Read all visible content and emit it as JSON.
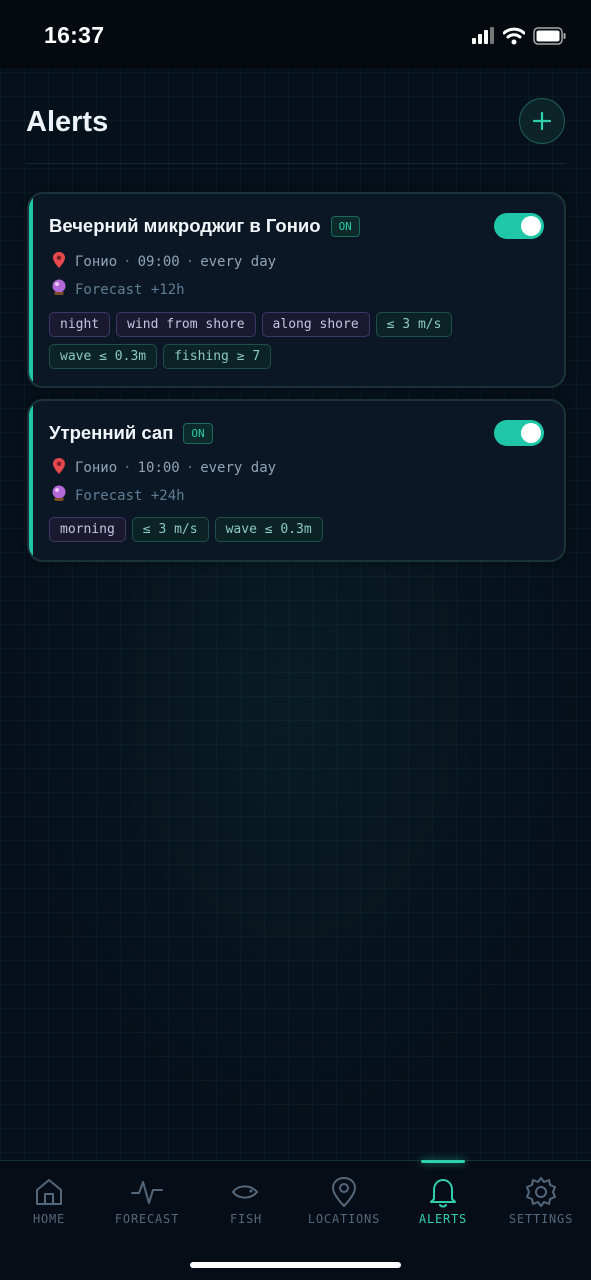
{
  "status_bar": {
    "time": "16:37"
  },
  "header": {
    "title": "Alerts",
    "add_icon": "plus-icon"
  },
  "alerts": [
    {
      "title": "Вечерний микроджиг в Гонио",
      "badge": "ON",
      "enabled": true,
      "location": "Гонио",
      "time": "09:00",
      "schedule": "every day",
      "forecast": "Forecast +12h",
      "tags": [
        {
          "text": "night",
          "style": "purple"
        },
        {
          "text": "wind from shore",
          "style": "purple"
        },
        {
          "text": "along shore",
          "style": "purple"
        },
        {
          "text": "≤ 3 m/s",
          "style": "teal"
        },
        {
          "text": "wave ≤ 0.3m",
          "style": "teal"
        },
        {
          "text": "fishing ≥ 7",
          "style": "teal"
        }
      ]
    },
    {
      "title": "Утренний сап",
      "badge": "ON",
      "enabled": true,
      "location": "Гонио",
      "time": "10:00",
      "schedule": "every day",
      "forecast": "Forecast +24h",
      "tags": [
        {
          "text": "morning",
          "style": "purple"
        },
        {
          "text": "≤ 3 m/s",
          "style": "teal"
        },
        {
          "text": "wave ≤ 0.3m",
          "style": "teal"
        }
      ]
    }
  ],
  "nav": {
    "items": [
      {
        "label": "HOME",
        "icon": "home-icon",
        "active": false
      },
      {
        "label": "FORECAST",
        "icon": "pulse-icon",
        "active": false
      },
      {
        "label": "FISH",
        "icon": "fish-icon",
        "active": false
      },
      {
        "label": "LOCATIONS",
        "icon": "map-pin-icon",
        "active": false
      },
      {
        "label": "ALERTS",
        "icon": "bell-icon",
        "active": true
      },
      {
        "label": "SETTINGS",
        "icon": "gear-icon",
        "active": false
      }
    ]
  },
  "colors": {
    "accent": "#1fc7a8",
    "background": "#060b14",
    "card": "#0b1724",
    "tag_purple": "#1a1930",
    "tag_teal": "#0c2326"
  }
}
